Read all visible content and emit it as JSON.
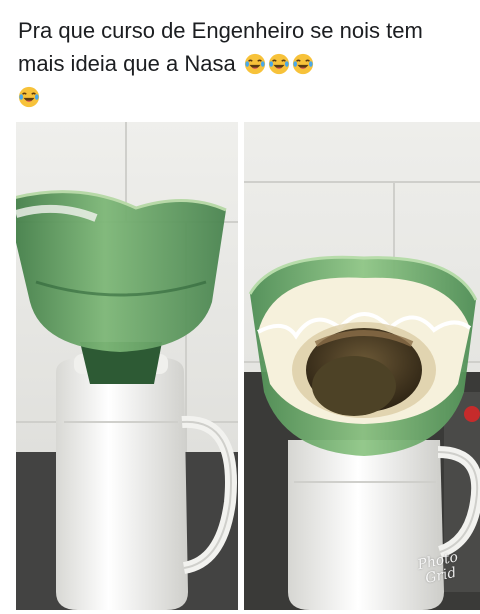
{
  "post": {
    "text": "Pra que curso de Engenheiro se nois tem mais ideia que a Nasa",
    "reaction_emoji": "laughing-with-tears-icon",
    "emoji_count": 4
  },
  "photos": [
    {
      "name": "left-photo",
      "subject": "green-bottle-funnel-on-thermos"
    },
    {
      "name": "right-photo",
      "subject": "filter-with-coffee-grounds-on-thermos"
    }
  ],
  "watermark": {
    "line1": "Photo",
    "line2": "Grid"
  },
  "colors": {
    "text": "#1c1e21",
    "emoji_yellow": "#f7c23a",
    "bottle_green": "#5f9a5a",
    "tile_wall": "#e9e9e6",
    "thermos_white": "#f4f4f2",
    "countertop": "#3a3a3a"
  }
}
